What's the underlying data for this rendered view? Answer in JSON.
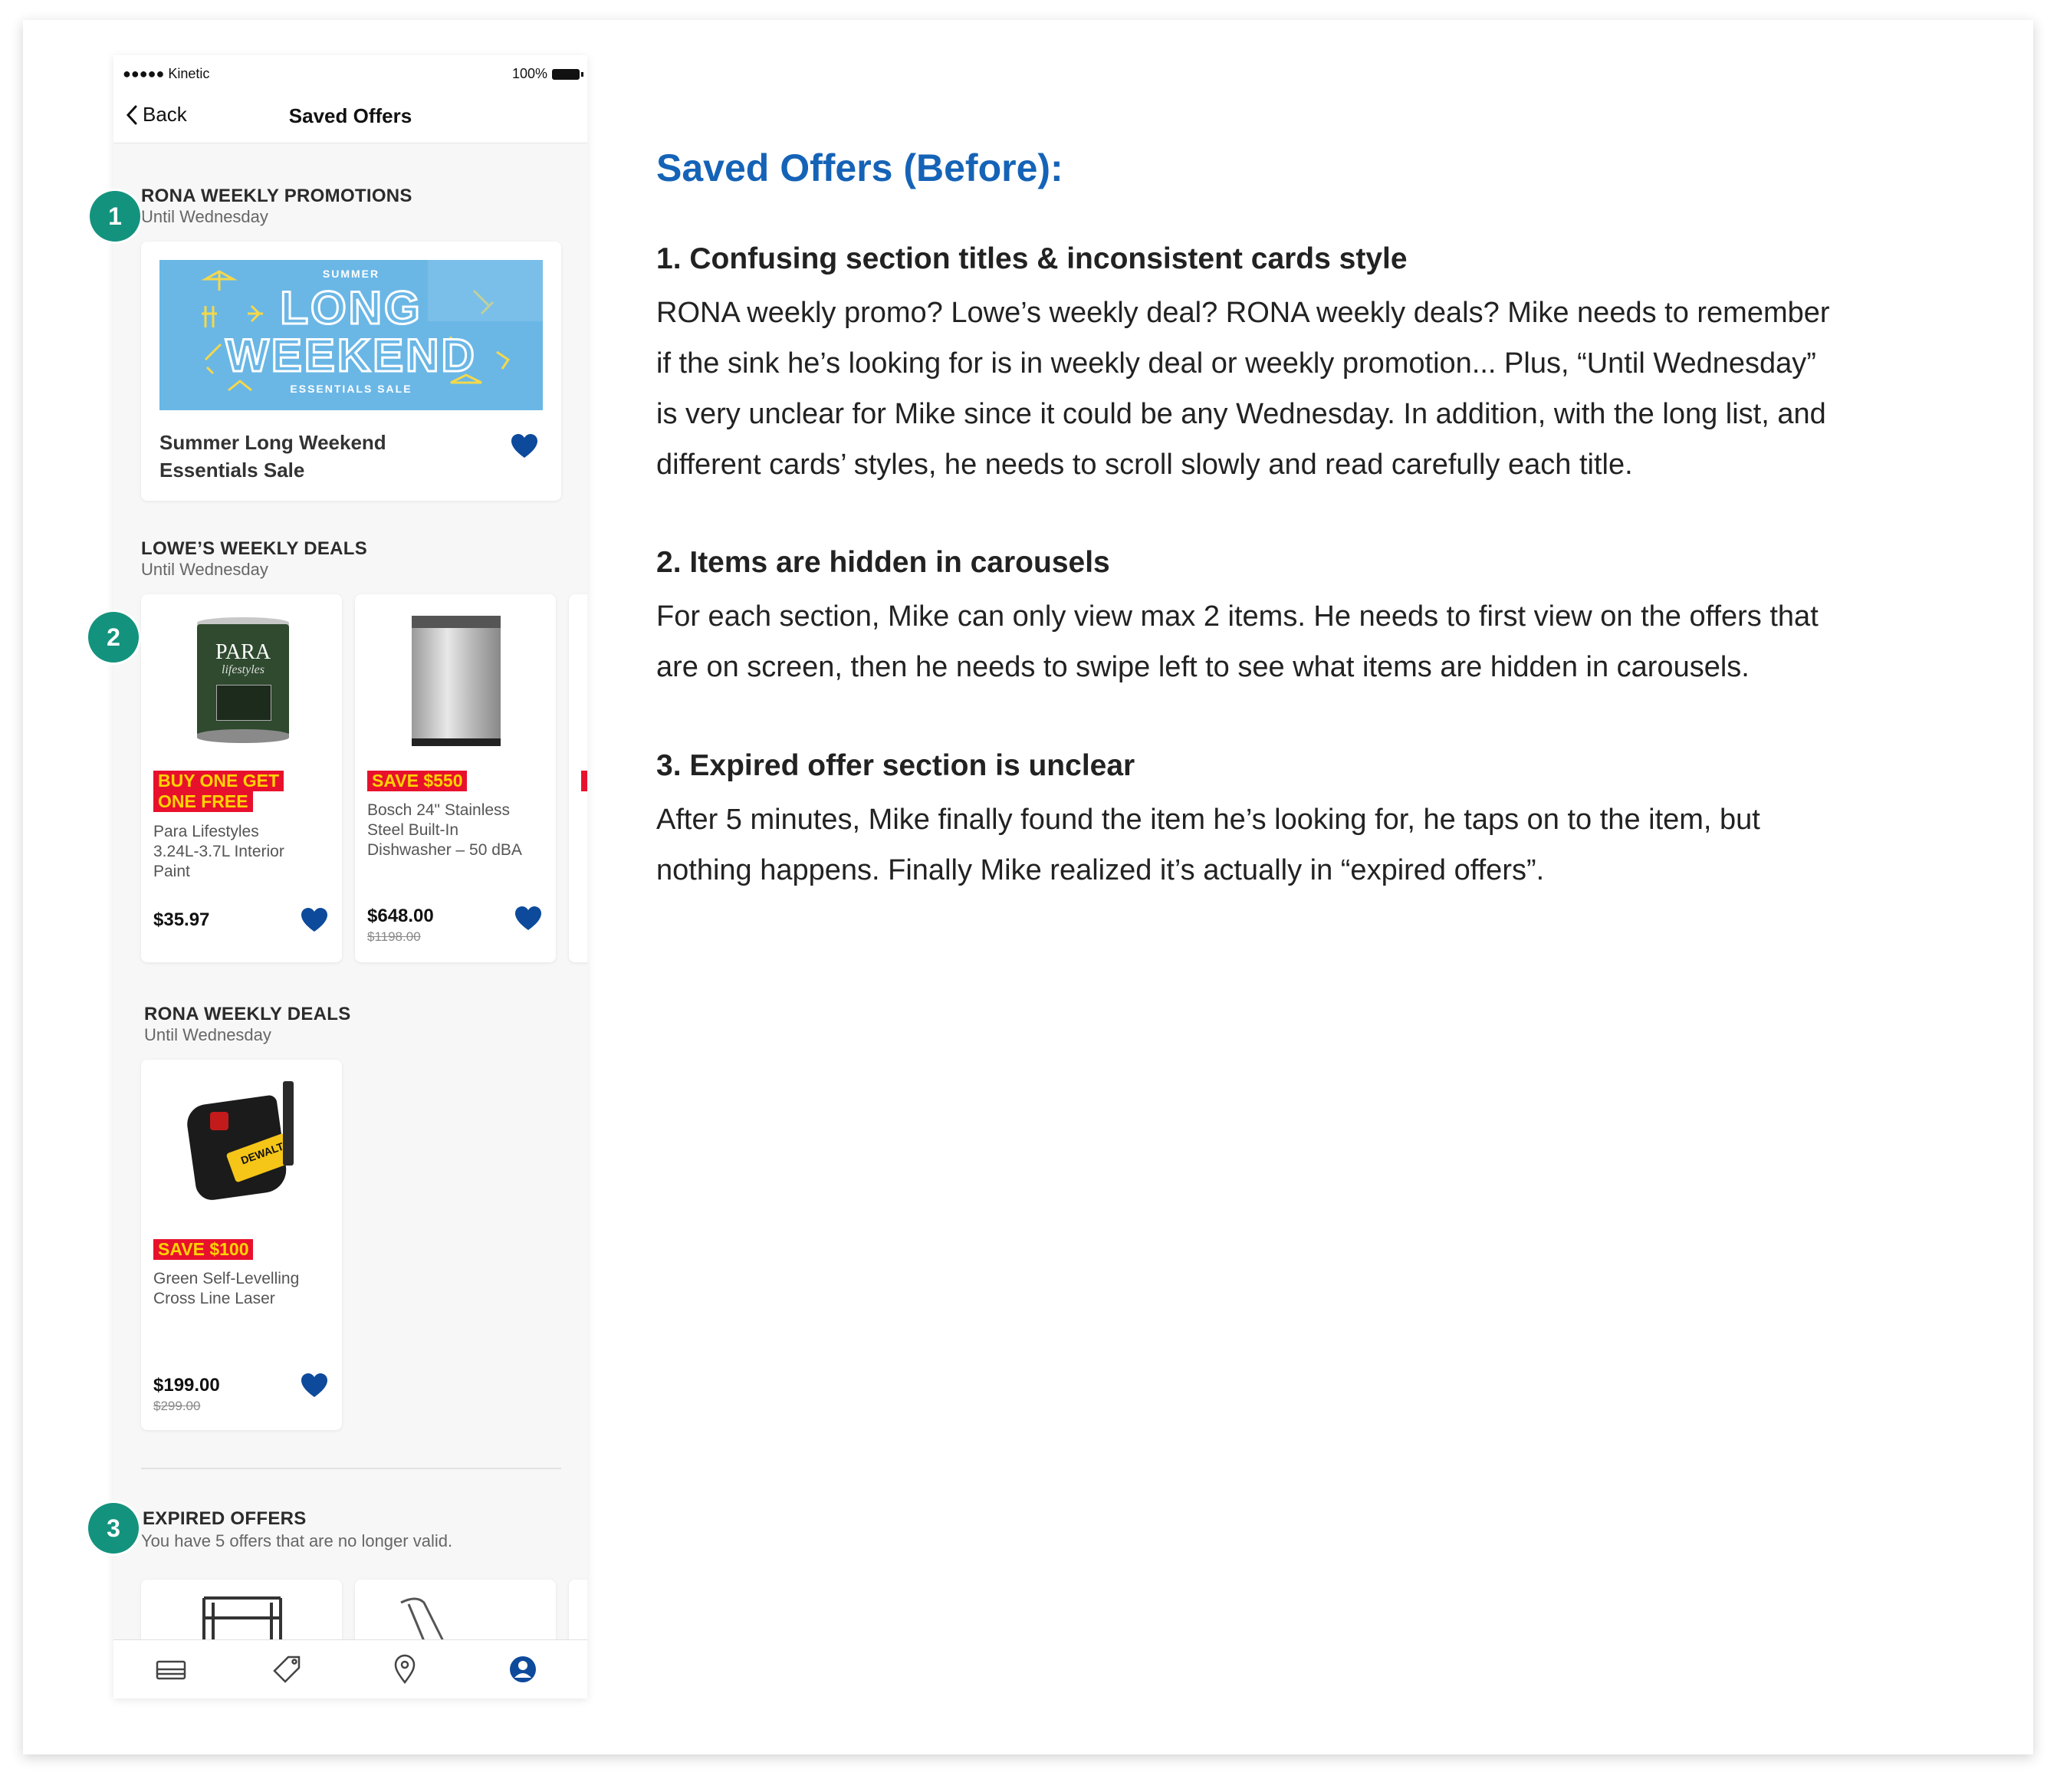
{
  "status": {
    "carrier": "●●●●● Kinetic",
    "battery": "100%"
  },
  "nav": {
    "back_label": "Back",
    "title": "Saved Offers"
  },
  "sections": {
    "promotions": {
      "title": "RONA WEEKLY PROMOTIONS",
      "subtitle": "Until Wednesday",
      "banner": {
        "top": "SUMMER",
        "line1": "LONG",
        "line2": "WEEKEND",
        "bottom": "ESSENTIALS SALE"
      },
      "card_title_1": "Summer Long Weekend",
      "card_title_2": "Essentials Sale"
    },
    "lowes": {
      "title": "LOWE’S WEEKLY DEALS",
      "subtitle": "Until Wednesday",
      "items": [
        {
          "badge_1": "BUY ONE GET",
          "badge_2": "ONE FREE",
          "name_1": "Para Lifestyles",
          "name_2": "3.24L-3.7L Interior",
          "name_3": "Paint",
          "price": "$35.97",
          "can_brand": "PARA",
          "can_sub": "lifestyles"
        },
        {
          "badge_1": "SAVE $550",
          "name_1": "Bosch 24\" Stainless",
          "name_2": "Steel Built-In",
          "name_3": "Dishwasher – 50 dBA",
          "price": "$648.00",
          "old_price": "$1198.00"
        }
      ]
    },
    "rona_deals": {
      "title": "RONA WEEKLY DEALS",
      "subtitle": "Until Wednesday",
      "item": {
        "badge": "SAVE $100",
        "name_1": "Green Self-Levelling",
        "name_2": "Cross Line Laser",
        "price": "$199.00",
        "old_price": "$299.00",
        "brand": "DEWALT"
      }
    },
    "expired": {
      "title": "EXPIRED OFFERS",
      "subtitle": "You have 5 offers that are no longer valid."
    }
  },
  "markers": [
    "1",
    "2",
    "3"
  ],
  "tabbar": [
    "flyer-icon",
    "tag-icon",
    "location-icon",
    "account-icon"
  ],
  "colors": {
    "accent": "#1563b7",
    "marker": "#13937e",
    "heart": "#0d4a9c",
    "badge_bg": "#e8112d",
    "badge_text": "#ffd400",
    "banner": "#6ab7e6"
  },
  "notes": {
    "heading": "Saved Offers (Before):",
    "items": [
      {
        "title": "1. Confusing section titles & inconsistent cards style",
        "lines": [
          "RONA weekly promo? Lowe’s weekly deal? RONA weekly deals? Mike needs to remember",
          "if the sink he’s looking for is in weekly deal or weekly promotion... Plus, “Until Wednesday”",
          "is very unclear for Mike since it could be any Wednesday. In addition, with the long list, and",
          "different cards’ styles, he needs to scroll slowly and read carefully each title."
        ]
      },
      {
        "title": "2. Items are hidden in carousels",
        "lines": [
          "For each section, Mike can only view max 2 items. He needs to first view on the offers that",
          "are on screen, then he needs to swipe left to see what items are hidden in carousels."
        ]
      },
      {
        "title": "3. Expired offer section is unclear",
        "lines": [
          "After 5 minutes, Mike finally found the item he’s looking for, he taps on to the item, but",
          "nothing happens. Finally Mike realized it’s actually in “expired offers”."
        ]
      }
    ]
  }
}
